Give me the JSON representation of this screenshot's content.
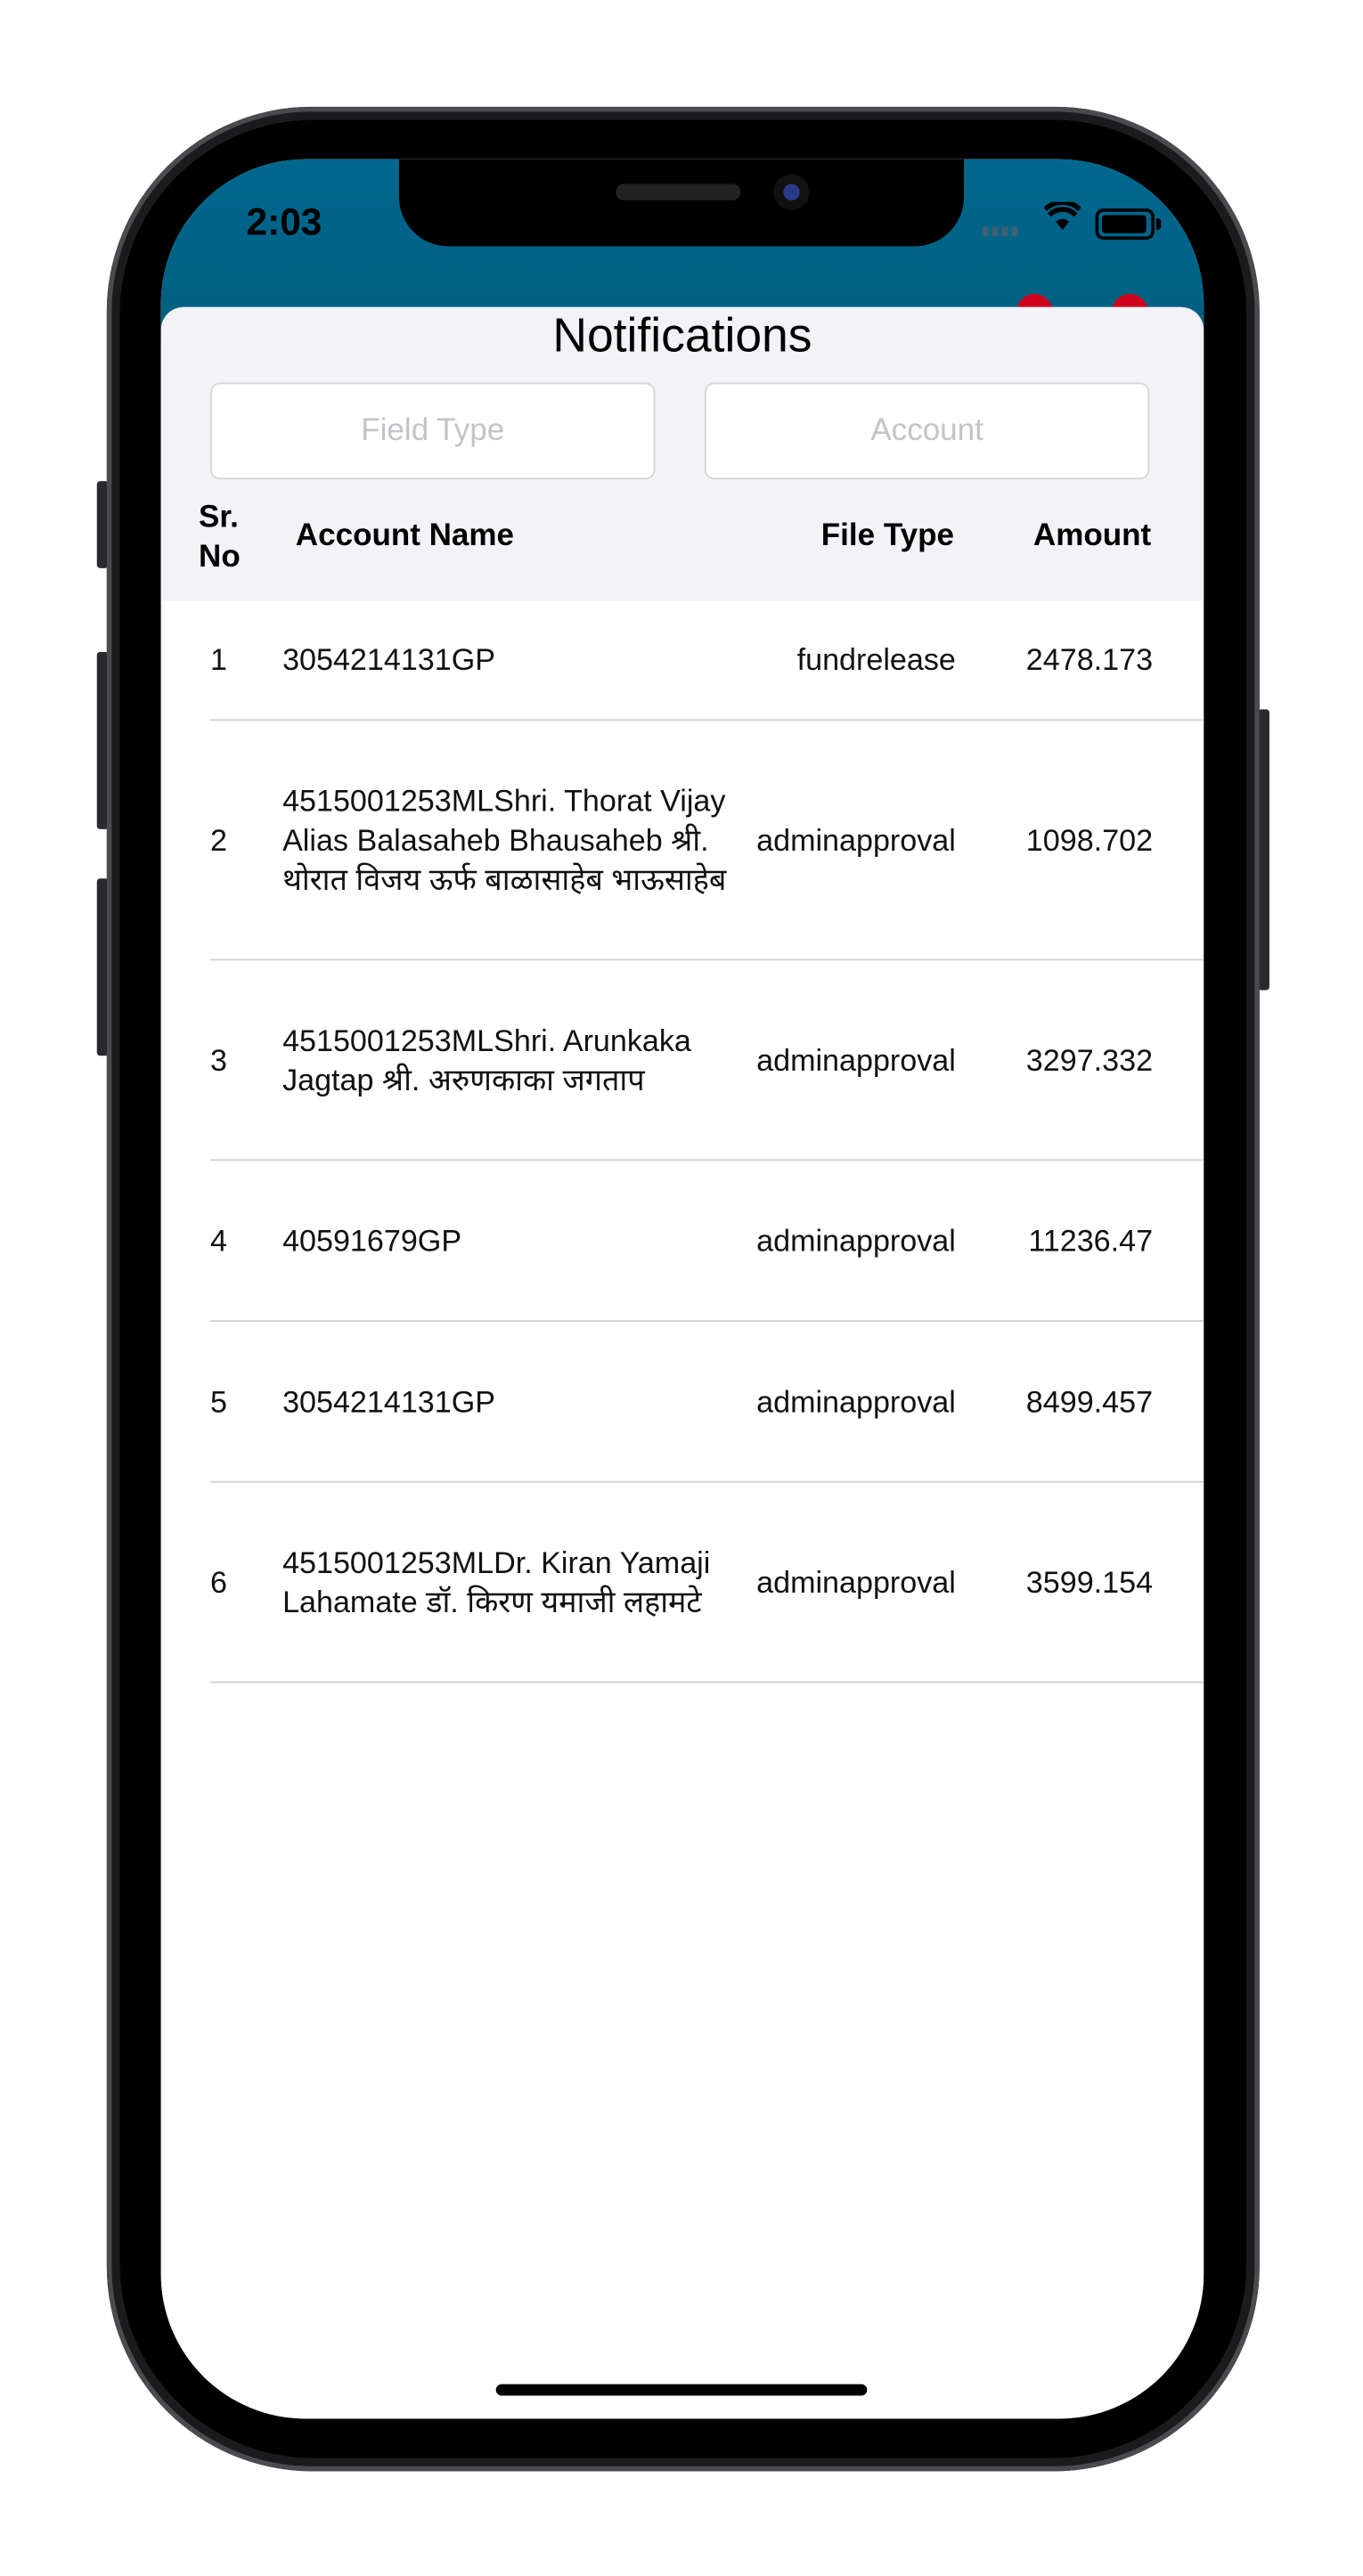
{
  "status_bar": {
    "time": "2:03",
    "wifi_icon": "wifi-icon",
    "battery_icon": "battery-icon"
  },
  "colors": {
    "header": "#006487",
    "sheet_header": "#f2f2f7",
    "badge": "#d0021b"
  },
  "sheet": {
    "title": "Notifications",
    "filters": {
      "field_type_placeholder": "Field Type",
      "account_placeholder": "Account"
    },
    "columns": {
      "sr_no": "Sr.\nNo",
      "account_name": "Account Name",
      "file_type": "File Type",
      "amount": "Amount"
    },
    "rows": [
      {
        "no": "1",
        "name": "3054214131GP",
        "type": "fundrelease",
        "amount": "2478.173"
      },
      {
        "no": "2",
        "name": "4515001253MLShri. Thorat Vijay Alias Balasaheb Bhausaheb   श्री. थोरात विजय ऊर्फ बाळासाहेब भाऊसाहेब",
        "type": "adminapproval",
        "amount": "1098.702"
      },
      {
        "no": "3",
        "name": "4515001253MLShri. Arunkaka Jagtap श्री. अरुणकाका जगताप",
        "type": "adminapproval",
        "amount": "3297.332"
      },
      {
        "no": "4",
        "name": "40591679GP",
        "type": "adminapproval",
        "amount": "11236.47"
      },
      {
        "no": "5",
        "name": "3054214131GP",
        "type": "adminapproval",
        "amount": "8499.457"
      },
      {
        "no": "6",
        "name": "4515001253MLDr. Kiran Yamaji Lahamate  डॉ. किरण यमाजी लहामटे",
        "type": "adminapproval",
        "amount": "3599.154"
      }
    ]
  }
}
